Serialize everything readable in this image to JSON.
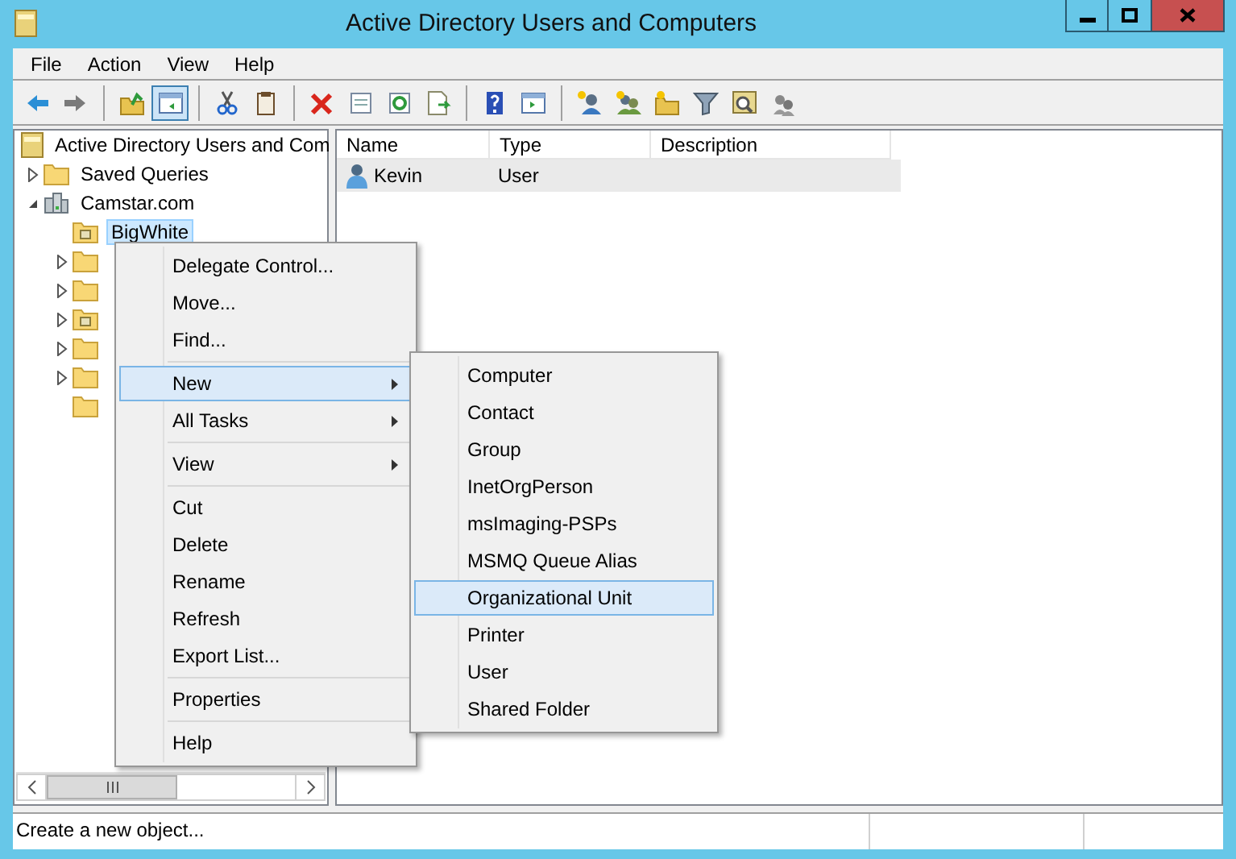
{
  "window": {
    "title": "Active Directory Users and Computers"
  },
  "menu_bar": [
    "File",
    "Action",
    "View",
    "Help"
  ],
  "toolbar_groups": [
    [
      {
        "pressed": false
      },
      {
        "pressed": false
      }
    ],
    [
      {
        "pressed": false
      },
      {
        "pressed": true
      }
    ],
    [
      {
        "pressed": false
      },
      {
        "pressed": false
      }
    ],
    [
      {
        "pressed": false
      },
      {
        "pressed": false
      },
      {
        "pressed": false
      },
      {
        "pressed": false
      }
    ],
    [
      {
        "pressed": false
      },
      {
        "pressed": false
      }
    ],
    [
      {
        "pressed": false
      },
      {
        "pressed": false
      },
      {
        "pressed": false
      },
      {
        "pressed": false
      },
      {
        "pressed": false
      },
      {
        "pressed": false
      }
    ]
  ],
  "tree": {
    "label": "Active Directory Users and Com",
    "children": [
      {
        "label": "Saved Queries",
        "kind": "folder",
        "expanded": false
      },
      {
        "label": "Camstar.com",
        "kind": "domain",
        "expanded": true,
        "children": [
          {
            "label": "BigWhite",
            "kind": "ou",
            "selected": true
          },
          {
            "kind": "folder",
            "expanded": false
          },
          {
            "kind": "folder",
            "expanded": false
          },
          {
            "kind": "ou",
            "expanded": false
          },
          {
            "kind": "folder",
            "expanded": false
          },
          {
            "kind": "folder",
            "expanded": false
          },
          {
            "kind": "folder"
          }
        ]
      }
    ]
  },
  "table": {
    "columns": [
      "Name",
      "Type",
      "Description"
    ],
    "rows": [
      {
        "name": "Kevin",
        "type": "User",
        "selected": true
      }
    ]
  },
  "context_menu": [
    {
      "kind": "item",
      "label": "Delegate Control...",
      "has_submenu": false,
      "selected": false
    },
    {
      "kind": "item",
      "label": "Move...",
      "has_submenu": false,
      "selected": false
    },
    {
      "kind": "item",
      "label": "Find...",
      "has_submenu": false,
      "selected": false
    },
    {
      "kind": "separator"
    },
    {
      "kind": "item",
      "label": "New",
      "has_submenu": true,
      "selected": true
    },
    {
      "kind": "item",
      "label": "All Tasks",
      "has_submenu": true,
      "selected": false
    },
    {
      "kind": "separator"
    },
    {
      "kind": "item",
      "label": "View",
      "has_submenu": true,
      "selected": false
    },
    {
      "kind": "separator"
    },
    {
      "kind": "item",
      "label": "Cut",
      "has_submenu": false,
      "selected": false
    },
    {
      "kind": "item",
      "label": "Delete",
      "has_submenu": false,
      "selected": false
    },
    {
      "kind": "item",
      "label": "Rename",
      "has_submenu": false,
      "selected": false
    },
    {
      "kind": "item",
      "label": "Refresh",
      "has_submenu": false,
      "selected": false
    },
    {
      "kind": "item",
      "label": "Export List...",
      "has_submenu": false,
      "selected": false
    },
    {
      "kind": "separator"
    },
    {
      "kind": "item",
      "label": "Properties",
      "has_submenu": false,
      "selected": false
    },
    {
      "kind": "separator"
    },
    {
      "kind": "item",
      "label": "Help",
      "has_submenu": false,
      "selected": false
    }
  ],
  "submenu": [
    {
      "label": "Computer",
      "selected": false
    },
    {
      "label": "Contact",
      "selected": false
    },
    {
      "label": "Group",
      "selected": false
    },
    {
      "label": "InetOrgPerson",
      "selected": false
    },
    {
      "label": "msImaging-PSPs",
      "selected": false
    },
    {
      "label": "MSMQ Queue Alias",
      "selected": false
    },
    {
      "label": "Organizational Unit",
      "selected": true
    },
    {
      "label": "Printer",
      "selected": false
    },
    {
      "label": "User",
      "selected": false
    },
    {
      "label": "Shared Folder",
      "selected": false
    }
  ],
  "status_bar": {
    "text": "Create a new object..."
  }
}
